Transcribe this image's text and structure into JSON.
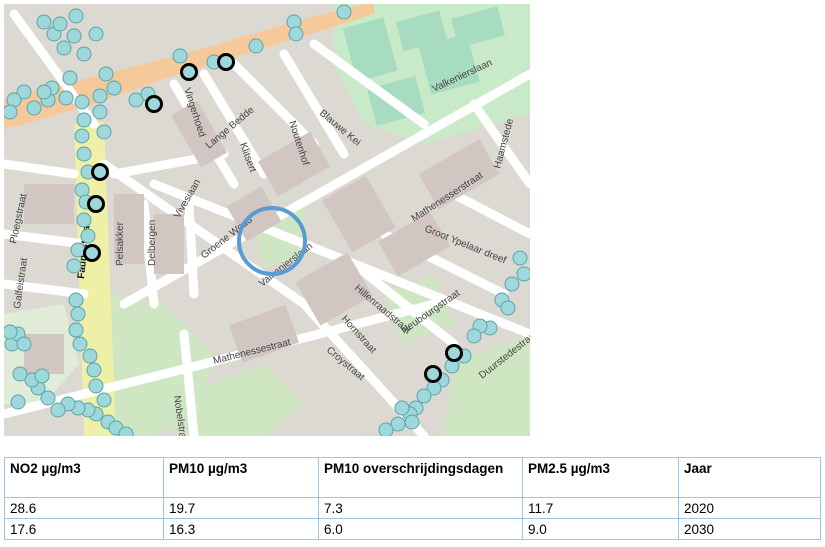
{
  "map": {
    "streets": [
      "Vingerhoed",
      "Lange Bedde",
      "Klitsert",
      "Noutenhof",
      "Blauwe Kei",
      "Valkenierslaan",
      "Haamstede",
      "Mathenesserstraat",
      "Groot Ypelaar dreef",
      "Vivesiaan",
      "Groene Woud",
      "Valkenierslaan",
      "Ploegstraat",
      "Faunastraat",
      "Pelsakker",
      "Delbergen",
      "Galfeistraat",
      "Hillenraadstraat",
      "Neubourgstraat",
      "Hornstraat",
      "Croystraat",
      "Mathenessestraat",
      "Nobelstraat",
      "Duurstedestraat"
    ],
    "marker_color": "#9fd8da",
    "highlight_ring_color": "#5b9bd5"
  },
  "table": {
    "headers": [
      "NO2 µg/m3",
      "PM10 µg/m3",
      "PM10 overschrijdingsdagen",
      "PM2.5 µg/m3",
      "Jaar"
    ],
    "rows": [
      [
        "28.6",
        "19.7",
        "7.3",
        "11.7",
        "2020"
      ],
      [
        "17.6",
        "16.3",
        "6.0",
        "9.0",
        "2030"
      ]
    ]
  }
}
